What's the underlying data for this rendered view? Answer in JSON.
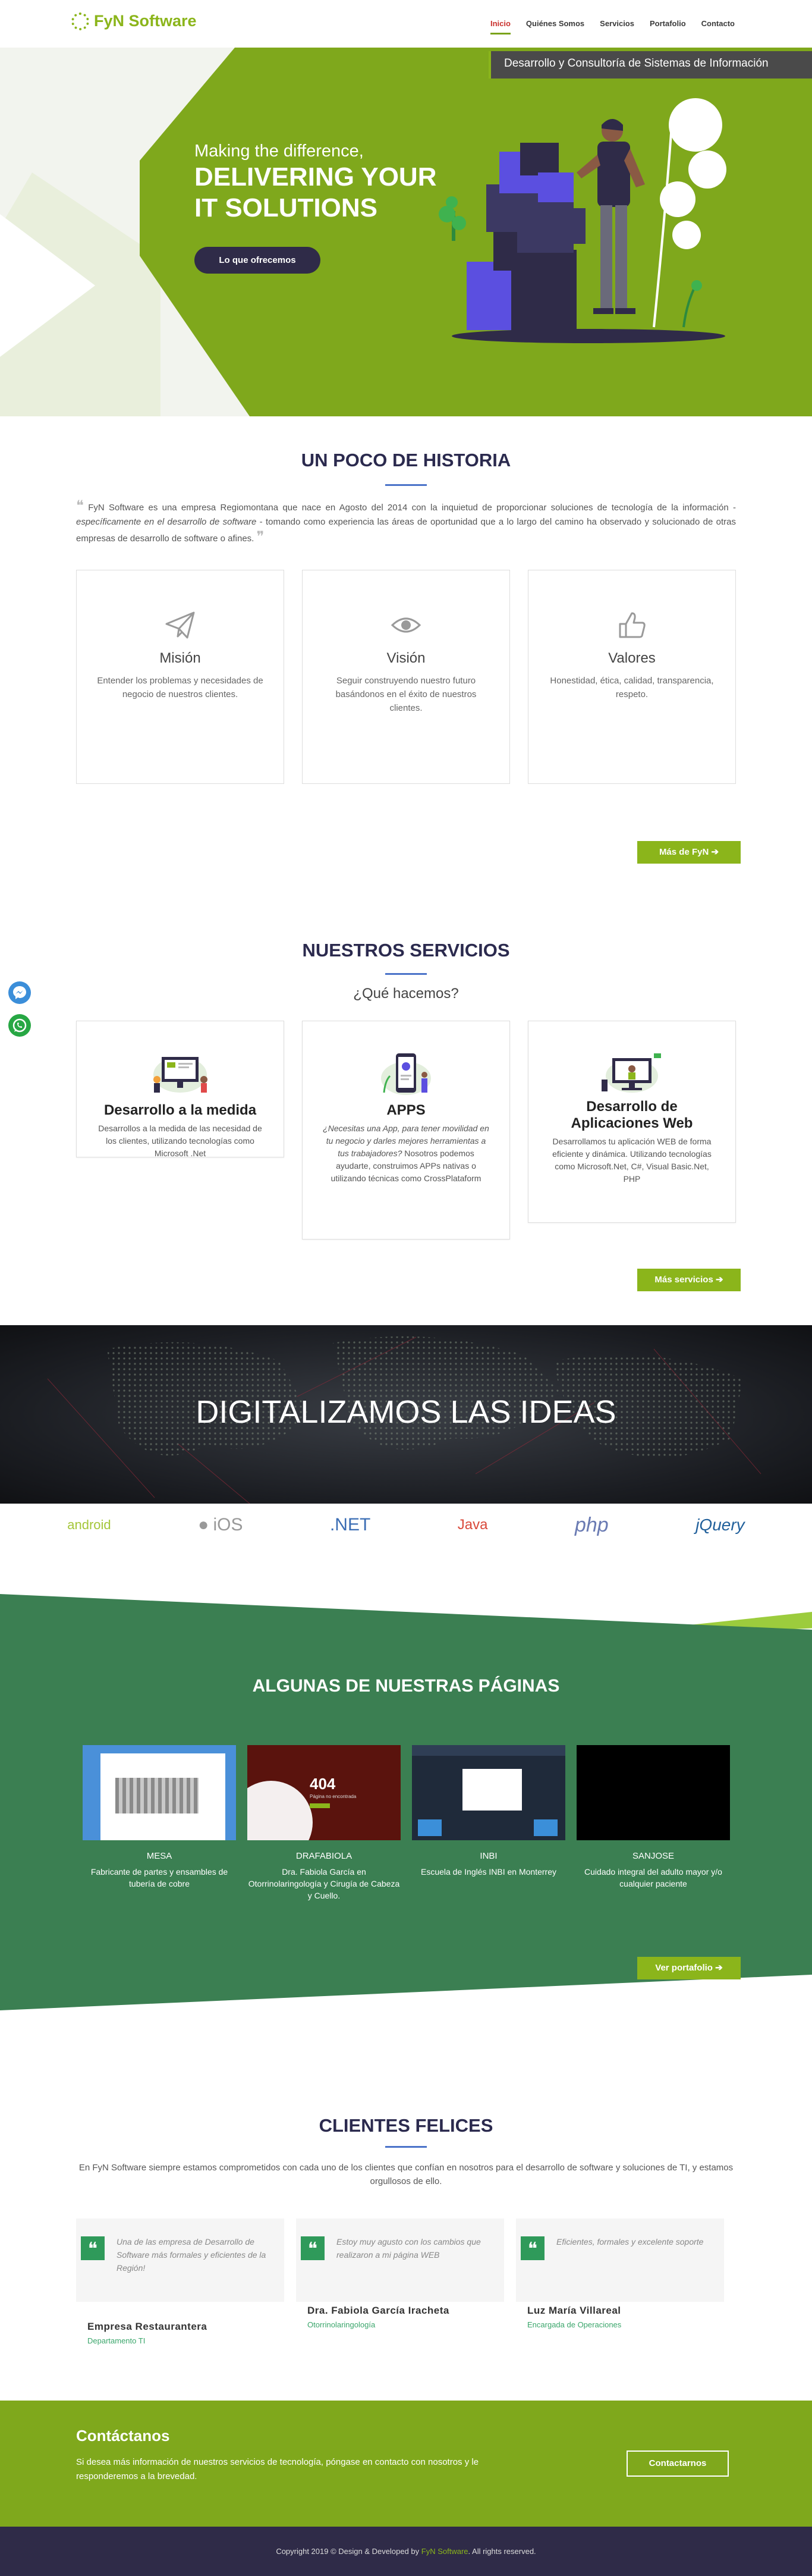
{
  "brand": {
    "name": "FyN Software",
    "green": "#8bb51b",
    "dark": "#2f2b48"
  },
  "nav": {
    "items": [
      "Inicio",
      "Quiénes Somos",
      "Servicios",
      "Portafolio",
      "Contacto"
    ]
  },
  "hero": {
    "bar": "Desarrollo y Consultoría de Sistemas de Información",
    "subtitle": "Making the difference,",
    "title_line1": "DELIVERING YOUR",
    "title_line2": "IT SOLUTIONS",
    "button": "Lo que ofrecemos"
  },
  "history": {
    "title": "UN POCO DE HISTORIA",
    "text_a": "FyN Software es una empresa Regiomontana que nace en Agosto del 2014 con la inquietud de proporcionar soluciones de tecnología de la información - ",
    "text_em": "específicamente en el desarrollo de software",
    "text_b": " - tomando como experiencia las áreas de oportunidad que a lo largo del camino ha observado y solucionado de otras empresas de desarrollo de software o afines.",
    "cards": [
      {
        "icon": "paper-plane-icon",
        "title": "Misión",
        "text": "Entender los problemas y necesidades de negocio de nuestros clientes."
      },
      {
        "icon": "eye-icon",
        "title": "Visión",
        "text": "Seguir construyendo nuestro futuro basándonos en el éxito de nuestros clientes."
      },
      {
        "icon": "thumbs-up-icon",
        "title": "Valores",
        "text": "Honestidad, ética, calidad, transparencia, respeto."
      }
    ],
    "more_button": "Más de FyN"
  },
  "services": {
    "title": "NUESTROS SERVICIOS",
    "subtitle": "¿Qué hacemos?",
    "cards": [
      {
        "title": "Desarrollo a la medida",
        "text": "Desarrollos a la medida de las necesidad de los clientes, utilizando tecnologías como Microsoft .Net"
      },
      {
        "title": "APPS",
        "text_em": "¿Necesitas una App, para tener movilidad en tu negocio y darles mejores herramientas a tus trabajadores?",
        "text": "Nosotros podemos ayudarte, construimos APPs nativas o utilizando técnicas como CrossPlataform"
      },
      {
        "title_line1": "Desarrollo de",
        "title_line2": "Aplicaciones Web",
        "text": "Desarrollamos tu aplicación WEB de forma eficiente y dinámica. Utilizando tecnologías como Microsoft.Net, C#, Visual Basic.Net, PHP"
      }
    ],
    "more_button": "Más servicios"
  },
  "banner": {
    "title": "DIGITALIZAMOS LAS IDEAS"
  },
  "tech_logos": [
    "android",
    "iOS",
    ".NET",
    "Java",
    "php",
    "jQuery"
  ],
  "portfolio": {
    "title": "ALGUNAS DE NUESTRAS PÁGINAS",
    "items": [
      {
        "name": "MESA",
        "desc": "Fabricante de partes y ensambles de tubería de cobre"
      },
      {
        "name": "DRAFABIOLA",
        "desc": "Dra. Fabiola García en Otorrinolaringología y Cirugía de Cabeza y Cuello.",
        "img_text": "404",
        "img_sub": "Página no encontrada"
      },
      {
        "name": "INBI",
        "desc": "Escuela de Inglés INBI en Monterrey"
      },
      {
        "name": "SANJOSE",
        "desc": "Cuidado integral del adulto mayor y/o cualquier paciente"
      }
    ],
    "button": "Ver portafolio"
  },
  "clients": {
    "title": "CLIENTES FELICES",
    "intro": "En FyN Software siempre estamos comprometidos con cada uno de los clientes que confían en nosotros para el desarrollo de software y soluciones de TI, y estamos orgullosos de ello.",
    "testimonials": [
      {
        "text": "Una de las empresa de Desarrollo de Software más formales y eficientes de la Región!",
        "name": "Empresa Restaurantera",
        "role": "Departamento TI"
      },
      {
        "text": "Estoy muy agusto con los cambios que realizaron a mi página WEB",
        "name": "Dra. Fabiola García Iracheta",
        "role": "Otorrinolaringología"
      },
      {
        "text": "Eficientes, formales y excelente soporte",
        "name": "Luz María Villareal",
        "role": "Encargada de Operaciones"
      }
    ]
  },
  "contact": {
    "title": "Contáctanos",
    "text": "Si desea más información de nuestros servicios de tecnología, póngase en contacto con nosotros y le responderemos a la brevedad.",
    "button": "Contactarnos"
  },
  "footer": {
    "prefix": "Copyright 2019 © Design & Developed by ",
    "brand": "FyN Software",
    "suffix": ". All rights reserved."
  }
}
